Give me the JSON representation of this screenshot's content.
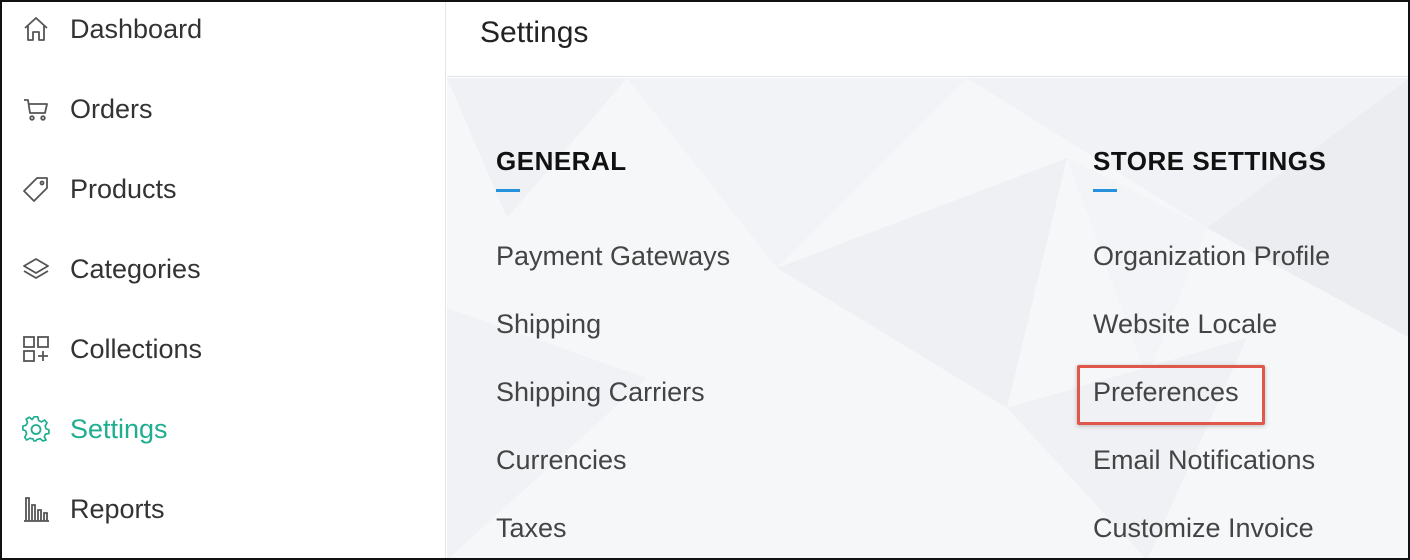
{
  "sidebar": {
    "items": [
      {
        "label": "Dashboard",
        "icon": "home-icon",
        "active": false
      },
      {
        "label": "Orders",
        "icon": "cart-icon",
        "active": false
      },
      {
        "label": "Products",
        "icon": "tag-icon",
        "active": false
      },
      {
        "label": "Categories",
        "icon": "layers-icon",
        "active": false
      },
      {
        "label": "Collections",
        "icon": "grid-plus-icon",
        "active": false
      },
      {
        "label": "Settings",
        "icon": "gear-icon",
        "active": true
      },
      {
        "label": "Reports",
        "icon": "bar-chart-icon",
        "active": false
      }
    ]
  },
  "header": {
    "title": "Settings"
  },
  "sections": {
    "general": {
      "heading": "GENERAL",
      "links": [
        "Payment Gateways",
        "Shipping",
        "Shipping Carriers",
        "Currencies",
        "Taxes"
      ]
    },
    "store": {
      "heading": "STORE SETTINGS",
      "links": [
        "Organization Profile",
        "Website Locale",
        "Preferences",
        "Email Notifications",
        "Customize Invoice"
      ]
    }
  },
  "colors": {
    "accent_active": "#1fae90",
    "underline": "#2493dc",
    "highlight_border": "#e0584c"
  }
}
